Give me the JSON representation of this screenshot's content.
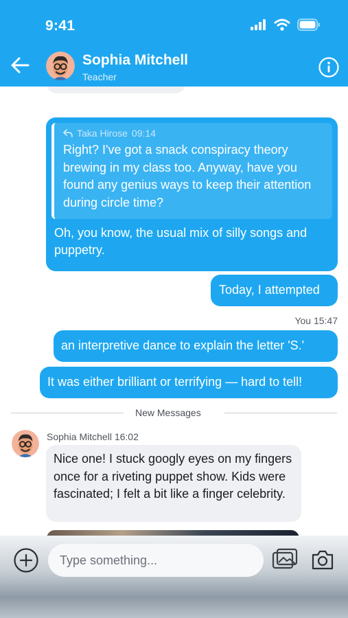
{
  "status_bar": {
    "time": "9:41",
    "icons": [
      "signal-icon",
      "wifi-icon",
      "battery-icon"
    ]
  },
  "header": {
    "contact_name": "Sophia Mitchell",
    "contact_role": "Teacher",
    "icons": [
      "back-arrow-icon",
      "avatar",
      "info-icon"
    ]
  },
  "messages": {
    "reply": {
      "quote_author": "Taka Hirose",
      "quote_time": "09:14",
      "quote_text": "Right? I've got a snack conspiracy theory brewing in my class too. Anyway, have you found any genius ways to keep their attention during circle time?",
      "text": "Oh, you know, the usual mix of silly songs and puppetry."
    },
    "out_2": "Today, I attempted",
    "out_meta": "You 15:47",
    "out_3": "an interpretive dance to explain the letter 'S.'",
    "out_4": "It was either brilliant or terrifying — hard to tell!",
    "divider_label": "New Messages",
    "incoming": {
      "author_time": "Sophia Mitchell 16:02",
      "text": "Nice one! I stuck googly eyes on my fingers once for a riveting puppet show. Kids were fascinated; I felt a bit like a finger celebrity."
    }
  },
  "composer": {
    "placeholder": "Type something...",
    "icons": [
      "plus-icon",
      "gallery-icon",
      "camera-icon"
    ]
  },
  "colors": {
    "accent": "#1ea7f0",
    "incoming_bubble": "#eef0f3",
    "quote_box": "#3ab3f3"
  }
}
